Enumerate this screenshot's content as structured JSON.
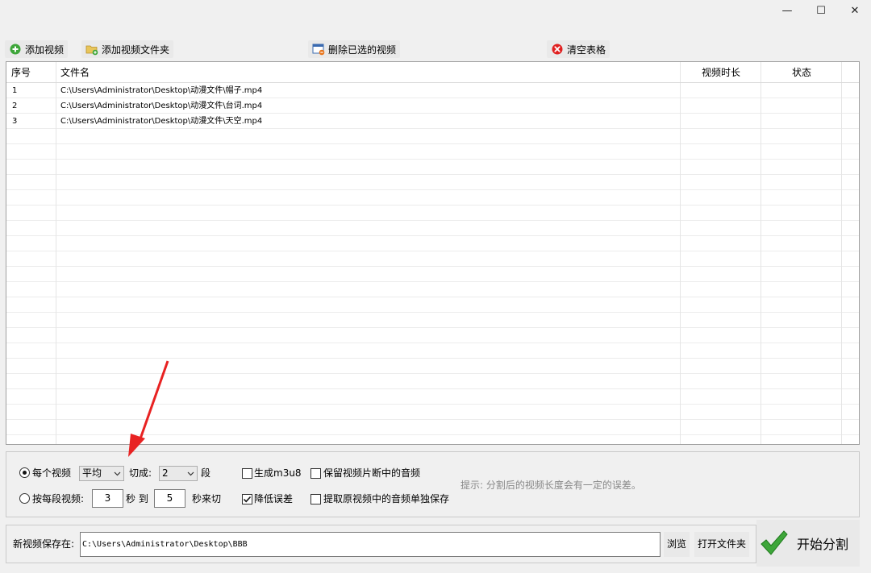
{
  "window": {
    "controls": {
      "minimize": "—",
      "maximize": "☐",
      "close": "✕"
    }
  },
  "toolbar": {
    "add_video": "添加视频",
    "add_folder": "添加视频文件夹",
    "delete_selected": "删除已选的视频",
    "clear_table": "清空表格"
  },
  "table": {
    "columns": [
      "序号",
      "文件名",
      "视频时长",
      "状态"
    ],
    "rows": [
      {
        "index": "1",
        "filename": "C:\\Users\\Administrator\\Desktop\\动漫文件\\帽子.mp4",
        "duration": "",
        "status": ""
      },
      {
        "index": "2",
        "filename": "C:\\Users\\Administrator\\Desktop\\动漫文件\\台词.mp4",
        "duration": "",
        "status": ""
      },
      {
        "index": "3",
        "filename": "C:\\Users\\Administrator\\Desktop\\动漫文件\\天空.mp4",
        "duration": "",
        "status": ""
      }
    ]
  },
  "options": {
    "mode_each_label": "每个视频",
    "mode_each_selected": true,
    "split_method": "平均",
    "cut_into_label": "切成:",
    "segments_value": "2",
    "segments_unit": "段",
    "mode_by_length_label": "按每段视频:",
    "mode_by_length_selected": false,
    "from_seconds": "3",
    "seconds_label": "秒 到",
    "to_seconds": "5",
    "seconds_cut_label": "秒来切",
    "generate_m3u8": {
      "label": "生成m3u8",
      "checked": false
    },
    "reduce_error": {
      "label": "降低误差",
      "checked": true
    },
    "keep_audio": {
      "label": "保留视频片断中的音频",
      "checked": false
    },
    "extract_audio": {
      "label": "提取原视频中的音频单独保存",
      "checked": false
    },
    "hint": "提示: 分割后的视频长度会有一定的误差。"
  },
  "save": {
    "label": "新视频保存在:",
    "path": "C:\\Users\\Administrator\\Desktop\\BBB",
    "browse": "浏览",
    "open_folder": "打开文件夹"
  },
  "start_button": "开始分割",
  "colors": {
    "toolbar_button_bg": "#e9e9e9",
    "green_accent": "#3ea63a",
    "red_accent": "#e02020",
    "annotation_arrow": "#e82222"
  },
  "icons": {
    "add_video": "green-plus-icon",
    "add_folder": "folder-plus-icon",
    "delete_selected": "window-remove-icon",
    "clear_table": "red-x-icon",
    "start": "green-checkmark-icon"
  }
}
